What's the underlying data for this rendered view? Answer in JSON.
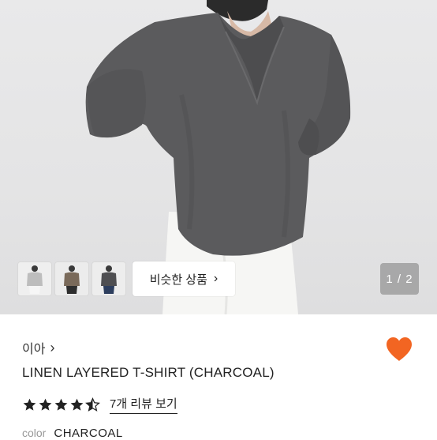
{
  "product": {
    "shop_name": "이아",
    "title": "LINEN LAYERED T-SHIRT (CHARCOAL)",
    "rating": 4.5,
    "review_link": "7개 리뷰 보기",
    "option_label": "color",
    "option_value": "CHARCOAL",
    "favorited": true
  },
  "gallery": {
    "similar_button": "비슷한 상품",
    "pager": "1 / 2",
    "thumbnails": [
      "light-gray-shirt",
      "brown-shirt",
      "charcoal-shirt"
    ]
  },
  "colors": {
    "heart": "#F26522",
    "shirt": "#5b5b5d",
    "pager_bg": "#969696"
  }
}
